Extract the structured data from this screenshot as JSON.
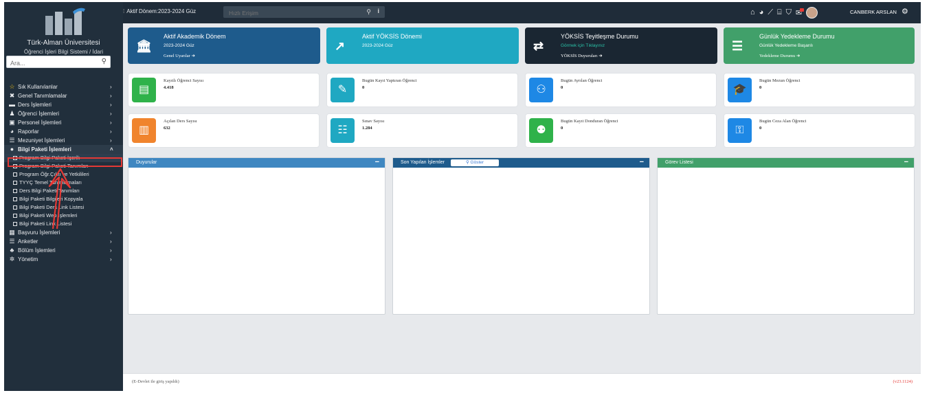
{
  "sidebar": {
    "university_name": "Türk-Alman Üniversitesi",
    "system_name": "Öğrenci İşleri Bilgi Sistemi / İdari",
    "search_placeholder": "Ara...",
    "menu": [
      {
        "label": "Sık Kullanılanlar",
        "icon": "star-icon",
        "glyph": "☆"
      },
      {
        "label": "Genel Tanımlamalar",
        "icon": "tools-icon",
        "glyph": "✖"
      },
      {
        "label": "Ders İşlemleri",
        "icon": "books-icon",
        "glyph": "▬"
      },
      {
        "label": "Öğrenci İşlemleri",
        "icon": "student-icon",
        "glyph": "♟"
      },
      {
        "label": "Personel İşlemleri",
        "icon": "id-card-icon",
        "glyph": "▣"
      },
      {
        "label": "Raporlar",
        "icon": "pie-chart-icon",
        "glyph": "◕"
      },
      {
        "label": "Mezuniyet İşlemleri",
        "icon": "list-icon",
        "glyph": "☰"
      },
      {
        "label": "Bilgi Paketi İşlemleri",
        "icon": "info-circle-icon",
        "glyph": "●"
      }
    ],
    "submenu": [
      "Program Bilgi Paketi İçerik",
      "Program Bilgi Paketi Tanımları",
      "Program Öğr.Çıktı ve Yetkilileri",
      "TYYÇ Temel Tanımlamaları",
      "Ders Bilgi Paketi Tanımları",
      "Bilgi Paketi Bilgileri Kopyala",
      "Bilgi Paketi Ders Link Listesi",
      "Bilgi Paketi Web İşlemleri",
      "Bilgi Paketi Link Listesi"
    ],
    "menu_after": [
      {
        "label": "Başvuru İşlemleri",
        "icon": "building-icon",
        "glyph": "▦"
      },
      {
        "label": "Anketler",
        "icon": "survey-list-icon",
        "glyph": "☰"
      },
      {
        "label": "Bölüm İşlemleri",
        "icon": "users-icon",
        "glyph": "♣"
      },
      {
        "label": "Yönetim",
        "icon": "cogs-icon",
        "glyph": "✲"
      }
    ]
  },
  "topbar": {
    "active_period": "Aktif Dönem:2023-2024 Güz",
    "quick_access_placeholder": "Hızlı Erişim",
    "user_name": "CANBERK ARSLAN"
  },
  "status_cards": [
    {
      "title": "Aktif Akademik Dönem",
      "subtitle": "2023-2024 Güz",
      "link": "Genel Uyarılar",
      "icon": "bank-icon",
      "glyph": "🏛"
    },
    {
      "title": "Aktif YÖKSİS Dönemi",
      "subtitle": "2023-2024 Güz",
      "link": "",
      "icon": "external-link-icon",
      "glyph": "↗"
    },
    {
      "title": "YÖKSİS Teyitleşme Durumu",
      "subtitle": "Görmek için Tıklayınız",
      "link": "YÖKSİS Duyuruları",
      "icon": "exchange-icon",
      "glyph": "⇄"
    },
    {
      "title": "Günlük Yedekleme Durumu",
      "subtitle": "Günlük Yedekleme Başarılı",
      "link": "Yedekleme Durumu",
      "icon": "database-icon",
      "glyph": "☰"
    }
  ],
  "stats": [
    {
      "label": "Kayıtlı Öğrenci Sayısı",
      "value": "4.418",
      "icon": "id-badge-icon",
      "color": "#2fb24a",
      "glyph": "▤"
    },
    {
      "label": "Bugün Kayıt Yaptıran Öğrenci",
      "value": "0",
      "icon": "edit-icon",
      "color": "#1fa8c2",
      "glyph": "✎"
    },
    {
      "label": "Bugün Ayrılan Öğrenci",
      "value": "0",
      "icon": "users-slash-icon",
      "color": "#1e88e5",
      "glyph": "⚇"
    },
    {
      "label": "Bugün Mezun Öğrenci",
      "value": "0",
      "icon": "graduation-cap-icon",
      "color": "#1e88e5",
      "glyph": "🎓"
    },
    {
      "label": "Açılan Ders Sayısı",
      "value": "632",
      "icon": "book-icon",
      "color": "#f0842d",
      "glyph": "▥"
    },
    {
      "label": "Sınav Sayısı",
      "value": "1.284",
      "icon": "list-alt-icon",
      "color": "#1fa8c2",
      "glyph": "☷"
    },
    {
      "label": "Bugün Kayıt Donduran Öğrenci",
      "value": "0",
      "icon": "user-shield-icon",
      "color": "#2fb24a",
      "glyph": "⚉"
    },
    {
      "label": "Bugün Ceza Alan Öğrenci",
      "value": "0",
      "icon": "user-lock-icon",
      "color": "#1e88e5",
      "glyph": "⚿"
    }
  ],
  "panels": [
    {
      "title": "Duyurular",
      "color": "#3f87c1"
    },
    {
      "title": "Son Yapılan İşlemler",
      "color": "#1e5b8c",
      "button": "Göster"
    },
    {
      "title": "Görev Listesi",
      "color": "#41a06a"
    }
  ],
  "footer": {
    "login_note": "(E-Devlet ile giriş yapıldı)",
    "version": "(v23.1124)"
  }
}
